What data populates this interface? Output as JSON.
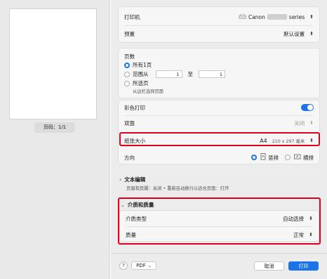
{
  "preview": {
    "page_counter": "页码：1/1"
  },
  "printer": {
    "label": "打印机",
    "value_prefix": "Canon",
    "value_suffix": "series"
  },
  "presets": {
    "label": "预置",
    "value": "默认设置"
  },
  "pages": {
    "label": "页数",
    "all_label": "所有1页",
    "range_label": "范围从",
    "range_from": "1",
    "range_to_label": "至",
    "range_to": "1",
    "selection_label": "所选页",
    "selection_hint": "从边栏选择页面"
  },
  "color_print": {
    "label": "彩色打印",
    "enabled": true
  },
  "duplex": {
    "label": "双面",
    "value": "关闭"
  },
  "paper_size": {
    "label": "纸张大小",
    "value": "A4",
    "dims": "210 x 297 毫米"
  },
  "orientation": {
    "label": "方向",
    "portrait": "竖排",
    "landscape": "横排",
    "selected": "portrait"
  },
  "text_edit": {
    "label": "文本编辑",
    "description": "页眉和页脚：关闭 • 重新自动换行以适合页面：打开"
  },
  "media_quality": {
    "label": "介质和质量",
    "media_type_label": "介质类型",
    "media_type_value": "自动选择",
    "quality_label": "质量",
    "quality_value": "正常"
  },
  "footer": {
    "help": "?",
    "pdf": "PDF",
    "cancel": "取消",
    "print": "打印"
  },
  "colors": {
    "accent": "#1a73e8",
    "highlight": "#e0001b"
  },
  "icons": {
    "stepper": "up-down-chevron-icon",
    "disclosure": "chevron-icon",
    "help": "question-icon"
  }
}
